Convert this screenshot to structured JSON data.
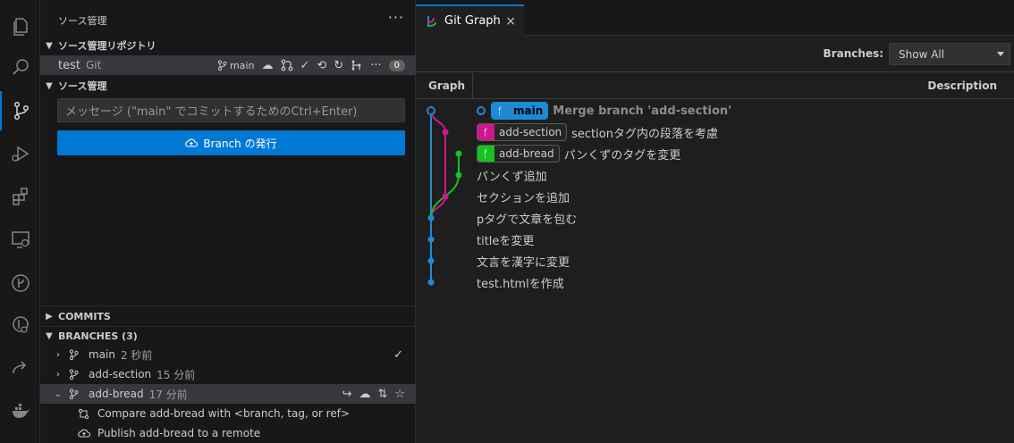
{
  "activity_bar": {
    "items": [
      {
        "icon": "files-icon"
      },
      {
        "icon": "search-icon"
      },
      {
        "icon": "source-control-icon"
      },
      {
        "icon": "run-debug-icon"
      },
      {
        "icon": "extensions-icon"
      },
      {
        "icon": "remote-explorer-icon"
      },
      {
        "icon": "git-graph-icon"
      },
      {
        "icon": "gitlens-icon"
      },
      {
        "icon": "live-share-icon"
      },
      {
        "icon": "docker-icon"
      }
    ]
  },
  "sidebar": {
    "title": "ソース管理",
    "more_label": "···",
    "repositories_header": "ソース管理リポジトリ",
    "repo": {
      "name": "test",
      "type": "Git",
      "branch": "main",
      "count": "0"
    },
    "source_control_header": "ソース管理",
    "message_placeholder": "メッセージ (\"main\" でコミットするためのCtrl+Enter)",
    "publish_label": "Branch の発行",
    "commits_header": "COMMITS",
    "branches_header": "BRANCHES (3)",
    "branches": [
      {
        "name": "main",
        "time": "2 秒前",
        "checked": "✓"
      },
      {
        "name": "add-section",
        "time": "15 分前"
      },
      {
        "name": "add-bread",
        "time": "17 分前"
      }
    ],
    "branch_actions": [
      {
        "label": "Compare add-bread with <branch, tag, or ref>"
      },
      {
        "label": "Publish add-bread to a remote"
      }
    ]
  },
  "editor": {
    "tab_title": "Git Graph",
    "tab_close": "×",
    "branches_label": "Branches:",
    "branches_value": "Show All",
    "col_graph": "Graph",
    "col_description": "Description",
    "commits": [
      {
        "refs": [
          {
            "name": "main",
            "kind": "main"
          }
        ],
        "message": "Merge branch 'add-section'",
        "head": true
      },
      {
        "refs": [
          {
            "name": "add-section",
            "kind": "section"
          }
        ],
        "message": "sectionタグ内の段落を考慮"
      },
      {
        "refs": [
          {
            "name": "add-bread",
            "kind": "bread"
          }
        ],
        "message": "パンくずのタグを変更"
      },
      {
        "refs": [],
        "message": "パンくず追加"
      },
      {
        "refs": [],
        "message": "セクションを追加"
      },
      {
        "refs": [],
        "message": "pタグで文章を包む"
      },
      {
        "refs": [],
        "message": "titleを変更"
      },
      {
        "refs": [],
        "message": "文言を漢字に変更"
      },
      {
        "refs": [],
        "message": "test.htmlを作成"
      }
    ],
    "colors": {
      "main": "#1d8ad6",
      "add_section": "#d1168f",
      "add_bread": "#14c41d",
      "accent": "#0078d4"
    }
  }
}
